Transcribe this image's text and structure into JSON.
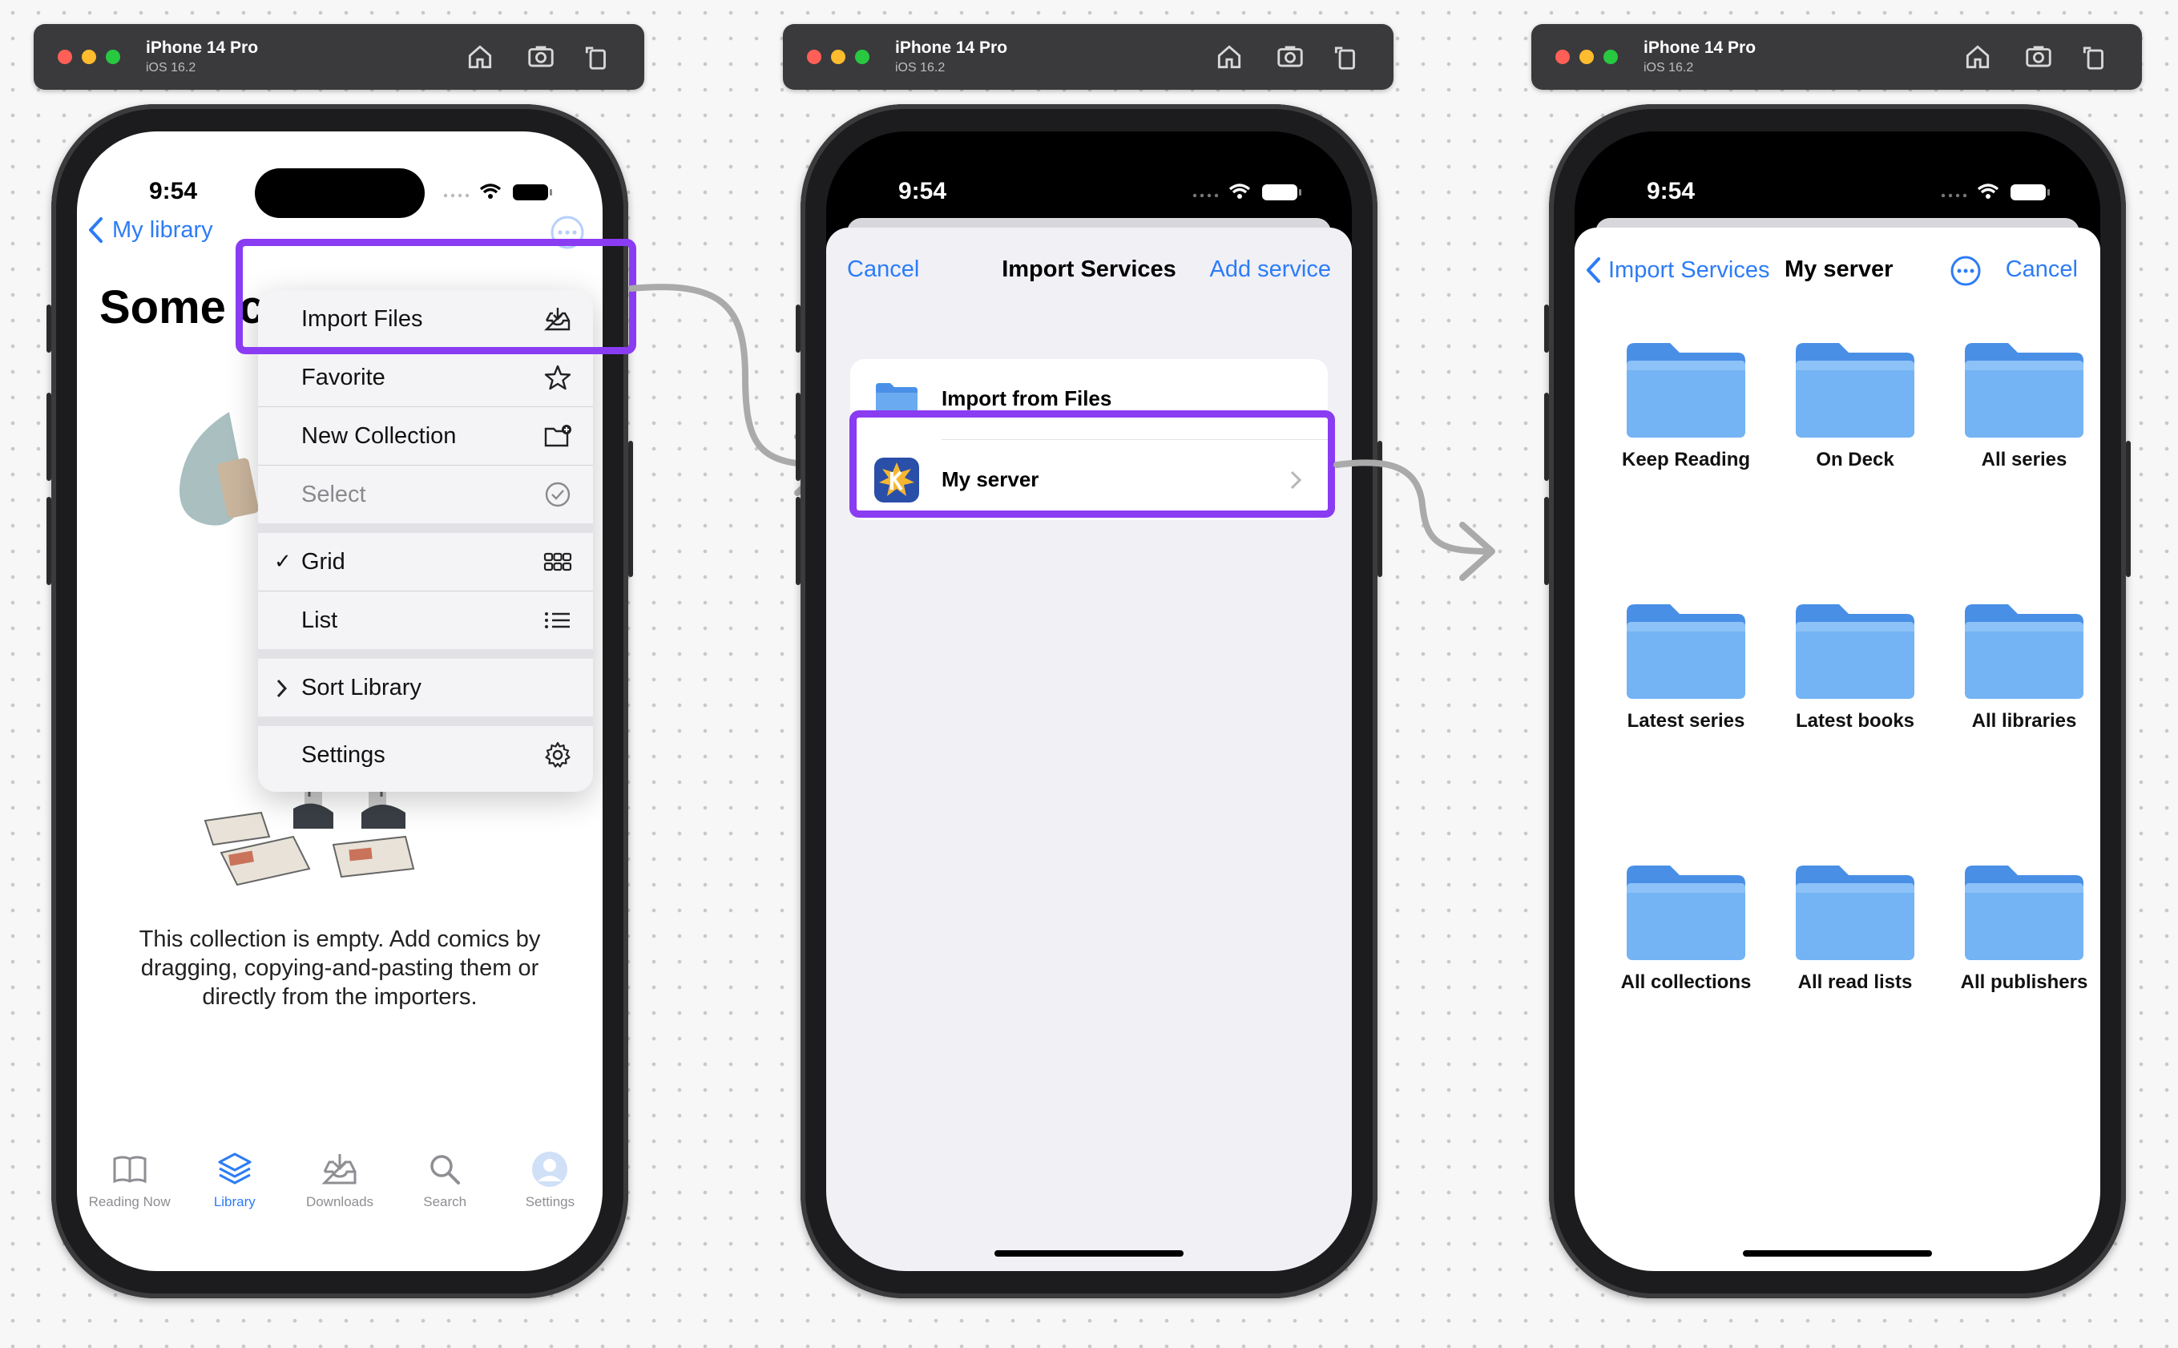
{
  "simulator": {
    "device": "iPhone 14 Pro",
    "os": "iOS 16.2"
  },
  "status": {
    "time": "9:54"
  },
  "phone1": {
    "back_label": "My library",
    "title": "Some c",
    "menu": [
      {
        "label": "Import Files",
        "icon": "tray-download-icon"
      },
      {
        "label": "Favorite",
        "icon": "star-icon"
      },
      {
        "label": "New Collection",
        "icon": "folder-plus-icon"
      },
      {
        "label": "Select",
        "icon": "checkmark-circle-icon",
        "disabled": true
      },
      {
        "label": "Grid",
        "icon": "grid-icon",
        "checked": true
      },
      {
        "label": "List",
        "icon": "list-icon"
      },
      {
        "label": "Sort Library",
        "icon": "chevron-right-icon"
      },
      {
        "label": "Settings",
        "icon": "gear-icon"
      }
    ],
    "empty_message": "This collection is empty. Add comics by dragging, copying-and-pasting them or directly from the importers.",
    "tabs": [
      {
        "label": "Reading Now",
        "icon": "book-icon"
      },
      {
        "label": "Library",
        "icon": "stack-icon",
        "active": true
      },
      {
        "label": "Downloads",
        "icon": "tray-download-icon"
      },
      {
        "label": "Search",
        "icon": "magnifier-icon"
      },
      {
        "label": "Settings",
        "icon": "avatar-icon"
      }
    ]
  },
  "phone2": {
    "cancel": "Cancel",
    "title": "Import Services",
    "add": "Add service",
    "rows": [
      {
        "label": "Import from Files",
        "icon": "folder-icon"
      },
      {
        "label": "My server",
        "icon": "komga-icon"
      }
    ]
  },
  "phone3": {
    "back_label": "Import Services",
    "title": "My server",
    "cancel": "Cancel",
    "folders": [
      "Keep Reading",
      "On Deck",
      "All series",
      "Latest series",
      "Latest books",
      "All libraries",
      "All collections",
      "All read lists",
      "All publishers"
    ]
  },
  "colors": {
    "accent": "#2d7cf6",
    "highlight": "#8a3cf2",
    "folder": "#6aaaf0"
  }
}
